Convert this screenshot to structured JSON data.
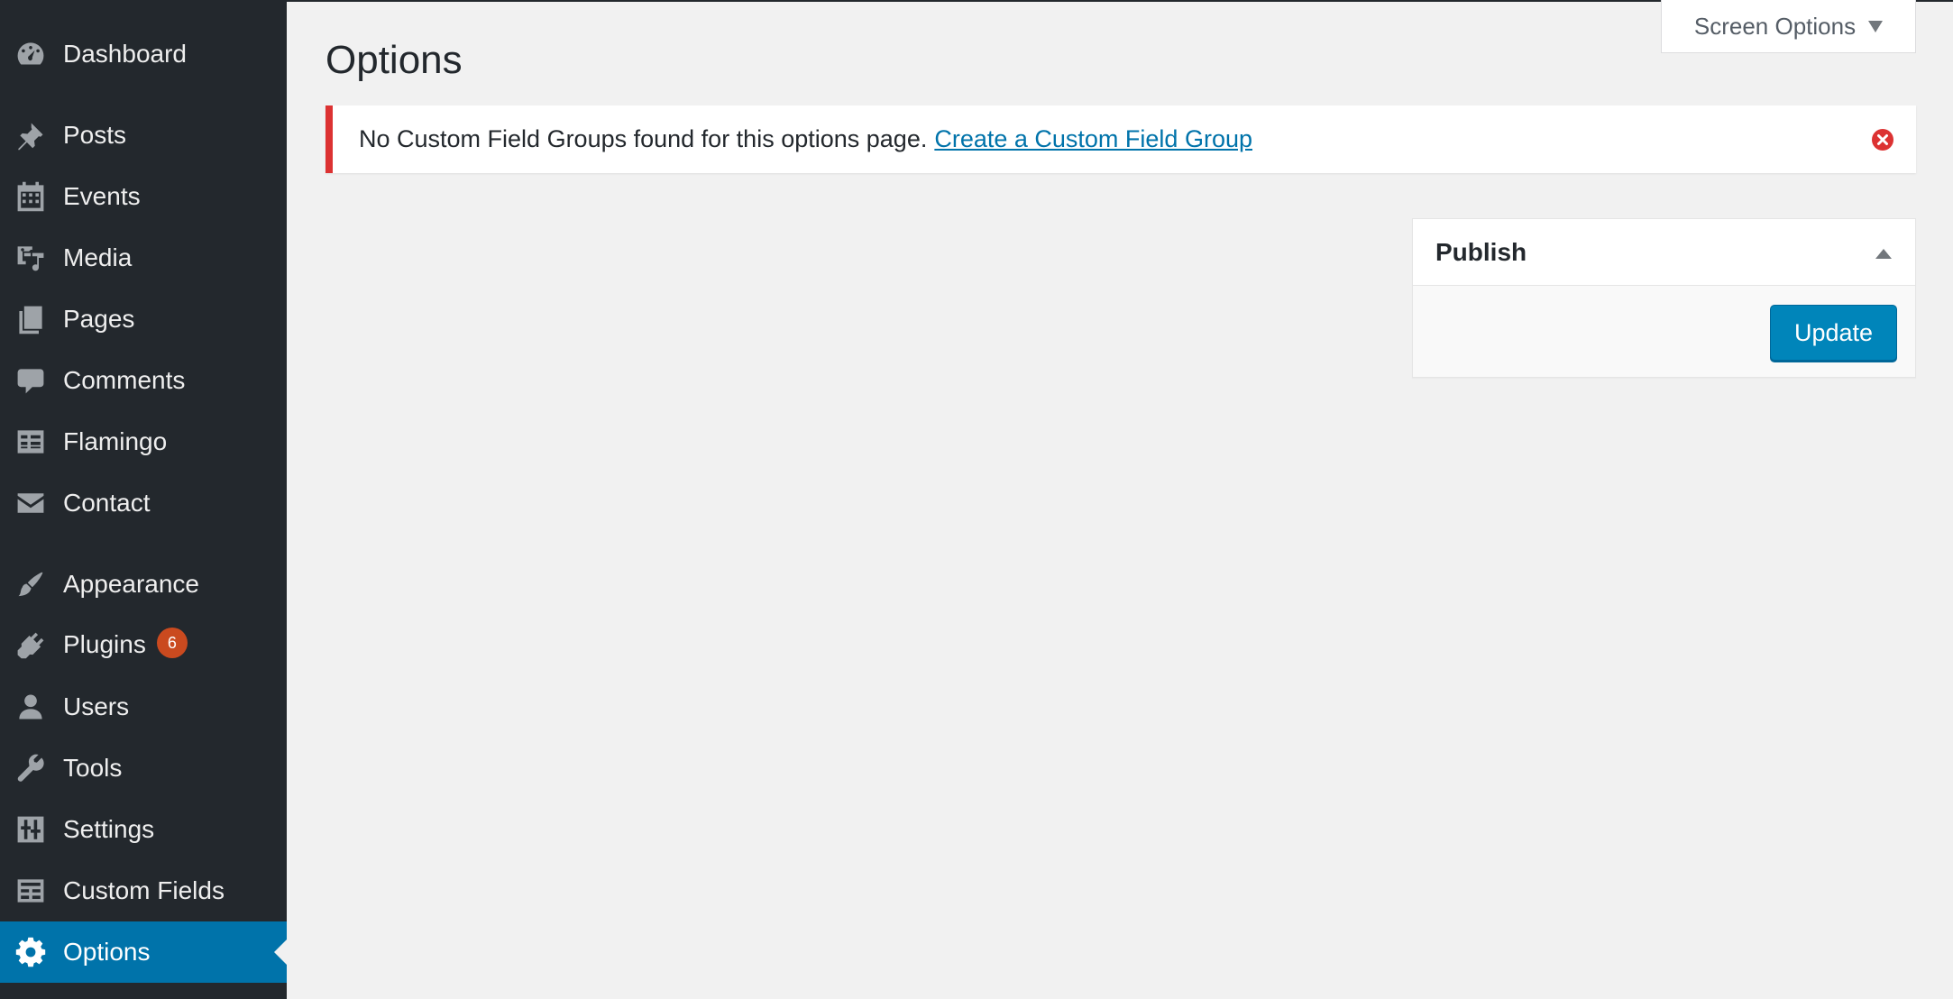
{
  "sidebar": {
    "items": [
      {
        "label": "Dashboard",
        "icon": "dashboard-icon"
      },
      {
        "label": "Posts",
        "icon": "pin-icon"
      },
      {
        "label": "Events",
        "icon": "calendar-icon"
      },
      {
        "label": "Media",
        "icon": "media-icon"
      },
      {
        "label": "Pages",
        "icon": "pages-icon"
      },
      {
        "label": "Comments",
        "icon": "comment-icon"
      },
      {
        "label": "Flamingo",
        "icon": "feedback-icon"
      },
      {
        "label": "Contact",
        "icon": "email-icon"
      },
      {
        "label": "Appearance",
        "icon": "paintbrush-icon"
      },
      {
        "label": "Plugins",
        "icon": "plugin-icon",
        "badge": "6"
      },
      {
        "label": "Users",
        "icon": "user-icon"
      },
      {
        "label": "Tools",
        "icon": "wrench-icon"
      },
      {
        "label": "Settings",
        "icon": "settings-sliders-icon"
      },
      {
        "label": "Custom Fields",
        "icon": "table-icon"
      },
      {
        "label": "Options",
        "icon": "gear-icon",
        "current": true
      }
    ]
  },
  "screen_options": {
    "label": "Screen Options"
  },
  "page": {
    "title": "Options"
  },
  "notice": {
    "message": "No Custom Field Groups found for this options page.",
    "link_text": "Create a Custom Field Group"
  },
  "publish": {
    "title": "Publish",
    "button_label": "Update"
  },
  "colors": {
    "sidebar_bg": "#23282d",
    "accent": "#0073aa",
    "notice_error": "#dc3232",
    "badge": "#ca4a1f",
    "button_primary": "#0085ba"
  }
}
